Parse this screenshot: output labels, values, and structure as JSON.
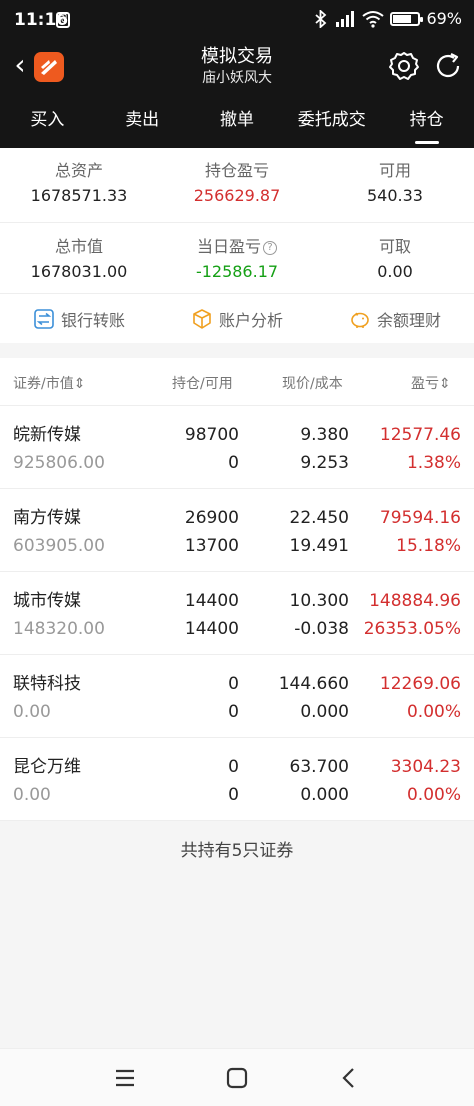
{
  "status_bar": {
    "time": "11:16",
    "battery": "69%",
    "battery_level": 0.69
  },
  "header": {
    "title": "模拟交易",
    "subtitle": "庙小妖风大"
  },
  "tabs": [
    {
      "label": "买入"
    },
    {
      "label": "卖出"
    },
    {
      "label": "撤单"
    },
    {
      "label": "委托成交"
    },
    {
      "label": "持仓"
    }
  ],
  "active_tab": "持仓",
  "summary": {
    "total_assets": {
      "label": "总资产",
      "value": "1678571.33"
    },
    "position_pnl": {
      "label": "持仓盈亏",
      "value": "256629.87"
    },
    "available": {
      "label": "可用",
      "value": "540.33"
    },
    "market_value": {
      "label": "总市值",
      "value": "1678031.00"
    },
    "daily_pnl": {
      "label": "当日盈亏",
      "value": "-12586.17",
      "help_icon": "?"
    },
    "withdrawable": {
      "label": "可取",
      "value": "0.00"
    }
  },
  "actions": [
    {
      "label": "银行转账",
      "icon": "transfer-icon"
    },
    {
      "label": "账户分析",
      "icon": "box-icon"
    },
    {
      "label": "余额理财",
      "icon": "piggy-bank-icon"
    }
  ],
  "table": {
    "headers": {
      "security": "证券/市值",
      "sort_glyph": "⇕",
      "position": "持仓/可用",
      "price": "现价/成本",
      "pnl": "盈亏",
      "pnl_sort_glyph": "⇕"
    },
    "rows": [
      {
        "name": "皖新传媒",
        "market_value": "925806.00",
        "position": "98700",
        "available": "0",
        "price": "9.380",
        "cost": "9.253",
        "pnl": "12577.46",
        "pnl_pct": "1.38%"
      },
      {
        "name": "南方传媒",
        "market_value": "603905.00",
        "position": "26900",
        "available": "13700",
        "price": "22.450",
        "cost": "19.491",
        "pnl": "79594.16",
        "pnl_pct": "15.18%"
      },
      {
        "name": "城市传媒",
        "market_value": "148320.00",
        "position": "14400",
        "available": "14400",
        "price": "10.300",
        "cost": "-0.038",
        "pnl": "148884.96",
        "pnl_pct": "26353.05%"
      },
      {
        "name": "联特科技",
        "market_value": "0.00",
        "position": "0",
        "available": "0",
        "price": "144.660",
        "cost": "0.000",
        "pnl": "12269.06",
        "pnl_pct": "0.00%"
      },
      {
        "name": "昆仑万维",
        "market_value": "0.00",
        "position": "0",
        "available": "0",
        "price": "63.700",
        "cost": "0.000",
        "pnl": "3304.23",
        "pnl_pct": "0.00%"
      }
    ]
  },
  "footer_note": "共持有5只证券",
  "colors": {
    "red": "#d32f2f",
    "green": "#15a015",
    "brand": "#ee5a1f",
    "dark": "#151515"
  }
}
